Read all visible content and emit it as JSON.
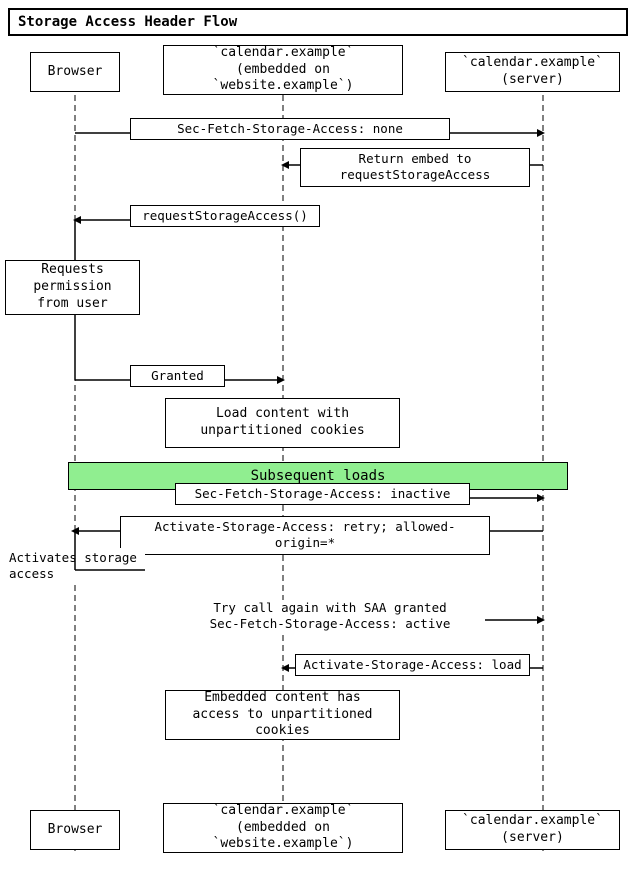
{
  "title": "Storage Access Header Flow",
  "actors": {
    "browser_top": "Browser",
    "calendar_embed_top": "`calendar.example`\n(embedded on `website.example`)",
    "calendar_server_top": "`calendar.example`\n(server)",
    "browser_bottom": "Browser",
    "calendar_embed_bottom": "`calendar.example`\n(embedded on `website.example`)",
    "calendar_server_bottom": "`calendar.example`\n(server)"
  },
  "messages": {
    "msg1": "Sec-Fetch-Storage-Access: none",
    "msg2_line1": "Return embed to",
    "msg2_line2": "requestStorageAccess",
    "msg3": "requestStorageAccess()",
    "msg4_line1": "Requests permission",
    "msg4_line2": "from user",
    "msg5": "Granted",
    "msg6_line1": "Load content with",
    "msg6_line2": "unpartitioned cookies",
    "msg7": "Subsequent loads",
    "msg8": "Sec-Fetch-Storage-Access: inactive",
    "msg9": "Activate-Storage-Access: retry; allowed-origin=*",
    "msg10_label": "Activates storage access",
    "msg11_line1": "Try call again with SAA granted",
    "msg11_line2": "Sec-Fetch-Storage-Access: active",
    "msg12": "Activate-Storage-Access: load",
    "msg13_line1": "Embedded content has",
    "msg13_line2": "access to unpartitioned cookies"
  }
}
